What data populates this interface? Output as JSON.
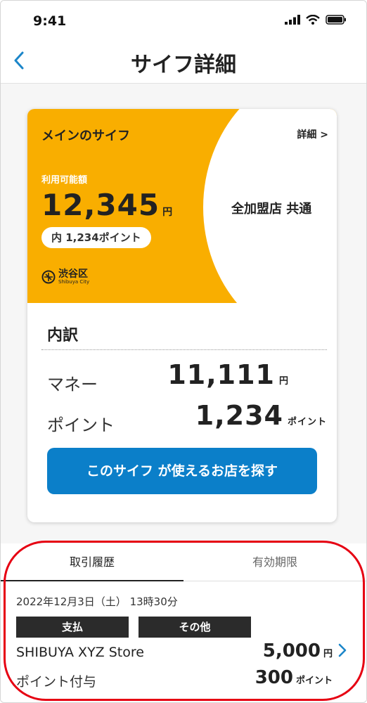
{
  "status_bar": {
    "time": "9:41"
  },
  "nav": {
    "back_icon": "chevron-left-icon",
    "title": "サイフ詳細"
  },
  "wallet": {
    "name": "メインのサイフ",
    "detail_link": "詳細 >",
    "available_label": "利用可能額",
    "balance": "12,345",
    "balance_unit": "円",
    "points_note": "内 1,234ポイント",
    "city_jp": "渋谷区",
    "city_en": "Shibuya City",
    "shop_type": "全加盟店 共通",
    "colors": {
      "card": "#f9ae00"
    }
  },
  "breakdown": {
    "title": "内訳",
    "money_label": "マネー",
    "money_value": "11,111",
    "money_unit": "円",
    "points_label": "ポイント",
    "points_value": "1,234",
    "points_unit": "ポイント",
    "find_button": "このサイフ が使えるお店を探す"
  },
  "tabs": [
    {
      "label": "取引履歴",
      "active": true
    },
    {
      "label": "有効期限",
      "active": false
    }
  ],
  "transaction": {
    "date": "2022年12月3日（土） 13時30分",
    "tags": [
      "支払",
      "その他"
    ],
    "store": "SHIBUYA XYZ Store",
    "amount": "5,000",
    "amount_unit": "円",
    "points_label": "ポイント付与",
    "points": "300",
    "points_unit": "ポイント"
  },
  "colors": {
    "accent": "#0b7fc9",
    "highlight": "#e60012"
  }
}
